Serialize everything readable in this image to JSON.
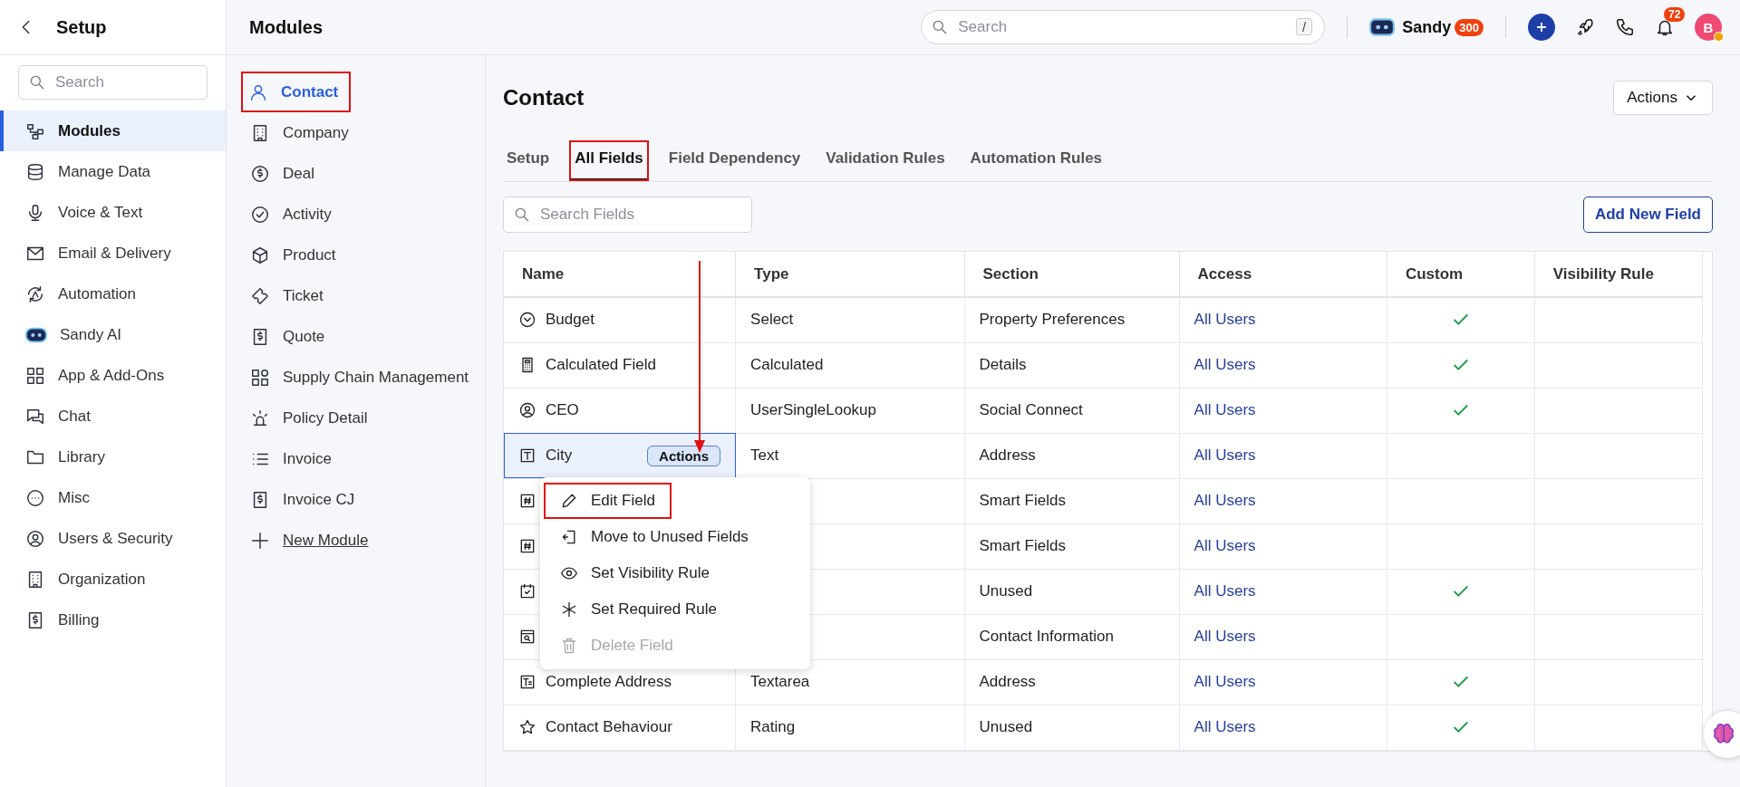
{
  "sidebar": {
    "title": "Setup",
    "search": {
      "placeholder": "Search"
    },
    "items": [
      {
        "label": "Modules",
        "selected": true
      },
      {
        "label": "Manage Data",
        "selected": false
      },
      {
        "label": "Voice & Text",
        "selected": false
      },
      {
        "label": "Email & Delivery",
        "selected": false
      },
      {
        "label": "Automation",
        "selected": false
      },
      {
        "label": "Sandy AI",
        "selected": false
      },
      {
        "label": "App & Add-Ons",
        "selected": false
      },
      {
        "label": "Chat",
        "selected": false
      },
      {
        "label": "Library",
        "selected": false
      },
      {
        "label": "Misc",
        "selected": false
      },
      {
        "label": "Users & Security",
        "selected": false
      },
      {
        "label": "Organization",
        "selected": false
      },
      {
        "label": "Billing",
        "selected": false
      }
    ]
  },
  "header": {
    "title": "Modules",
    "search": {
      "placeholder": "Search",
      "shortcut": "/"
    },
    "assistant": {
      "name": "Sandy",
      "badge": "300"
    },
    "notifications": {
      "badge": "72"
    },
    "avatar": {
      "initial": "B"
    }
  },
  "modules": {
    "items": [
      {
        "label": "Contact",
        "selected": true,
        "annotated": true
      },
      {
        "label": "Company",
        "selected": false,
        "annotated": false
      },
      {
        "label": "Deal",
        "selected": false,
        "annotated": false
      },
      {
        "label": "Activity",
        "selected": false,
        "annotated": false
      },
      {
        "label": "Product",
        "selected": false,
        "annotated": false
      },
      {
        "label": "Ticket",
        "selected": false,
        "annotated": false
      },
      {
        "label": "Quote",
        "selected": false,
        "annotated": false
      },
      {
        "label": "Supply Chain Management",
        "selected": false,
        "annotated": false
      },
      {
        "label": "Policy Detail",
        "selected": false,
        "annotated": false
      },
      {
        "label": "Invoice",
        "selected": false,
        "annotated": false
      },
      {
        "label": "Invoice CJ",
        "selected": false,
        "annotated": false
      }
    ],
    "new_module": "New Module"
  },
  "content": {
    "title": "Contact",
    "actions_button": "Actions",
    "tabs": [
      {
        "label": "Setup",
        "selected": false,
        "annotated": false
      },
      {
        "label": "All Fields",
        "selected": true,
        "annotated": true
      },
      {
        "label": "Field Dependency",
        "selected": false,
        "annotated": false
      },
      {
        "label": "Validation Rules",
        "selected": false,
        "annotated": false
      },
      {
        "label": "Automation Rules",
        "selected": false,
        "annotated": false
      }
    ],
    "search": {
      "placeholder": "Search Fields"
    },
    "add_button": "Add New Field",
    "table": {
      "columns": [
        "Name",
        "Type",
        "Section",
        "Access",
        "Custom",
        "Visibility Rule"
      ],
      "rows": [
        {
          "name": "Budget",
          "type": "Select",
          "section": "Property Preferences",
          "access": "All Users",
          "custom": true,
          "selected": false
        },
        {
          "name": "Calculated Field",
          "type": "Calculated",
          "section": "Details",
          "access": "All Users",
          "custom": true,
          "selected": false
        },
        {
          "name": "CEO",
          "type": "UserSingleLookup",
          "section": "Social Connect",
          "access": "All Users",
          "custom": true,
          "selected": false
        },
        {
          "name": "City",
          "type": "Text",
          "section": "Address",
          "access": "All Users",
          "custom": false,
          "selected": true,
          "actions_label": "Actions"
        },
        {
          "section": "Smart Fields",
          "access": "All Users",
          "custom": false,
          "selected": false
        },
        {
          "section": "Smart Fields",
          "access": "All Users",
          "custom": false,
          "selected": false
        },
        {
          "section": "Unused",
          "access": "All Users",
          "custom": true,
          "selected": false
        },
        {
          "section": "Contact Information",
          "access": "All Users",
          "custom": false,
          "selected": false
        },
        {
          "name": "Complete Address",
          "type": "Textarea",
          "section": "Address",
          "access": "All Users",
          "custom": true,
          "selected": false
        },
        {
          "name": "Contact Behaviour",
          "type": "Rating",
          "section": "Unused",
          "access": "All Users",
          "custom": true,
          "selected": false
        }
      ]
    },
    "row_menu": {
      "items": [
        {
          "label": "Edit Field",
          "disabled": false,
          "annotated": true
        },
        {
          "label": "Move to Unused Fields",
          "disabled": false,
          "annotated": false
        },
        {
          "label": "Set Visibility Rule",
          "disabled": false,
          "annotated": false
        },
        {
          "label": "Set Required Rule",
          "disabled": false,
          "annotated": false
        },
        {
          "label": "Delete Field",
          "disabled": true,
          "annotated": false
        }
      ]
    }
  }
}
